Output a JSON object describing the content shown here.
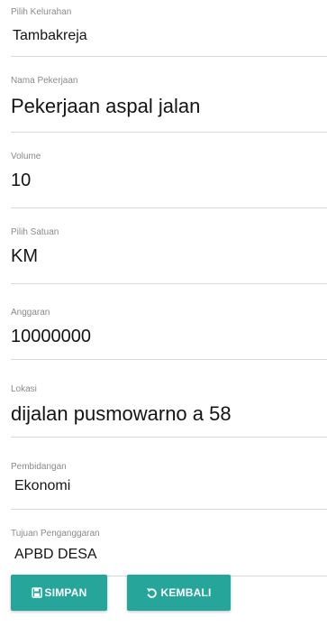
{
  "form": {
    "fields": [
      {
        "label": "Pilih Kelurahan",
        "value": "Tambakreja"
      },
      {
        "label": "Nama Pekerjaan",
        "value": "Pekerjaan aspal jalan"
      },
      {
        "label": "Volume",
        "value": "10"
      },
      {
        "label": "Pilih Satuan",
        "value": "KM"
      },
      {
        "label": "Anggaran",
        "value": "10000000"
      },
      {
        "label": "Lokasi",
        "value": "dijalan pusmowarno a 58"
      },
      {
        "label": "Pembidangan",
        "value": "Ekonomi"
      },
      {
        "label": "Tujuan Penganggaran",
        "value": "APBD DESA"
      }
    ]
  },
  "buttons": {
    "save_label": "SIMPAN",
    "save_icon": "save-icon",
    "back_label": "KEMBALI",
    "back_icon": "undo-icon",
    "color": "#26a69a"
  }
}
